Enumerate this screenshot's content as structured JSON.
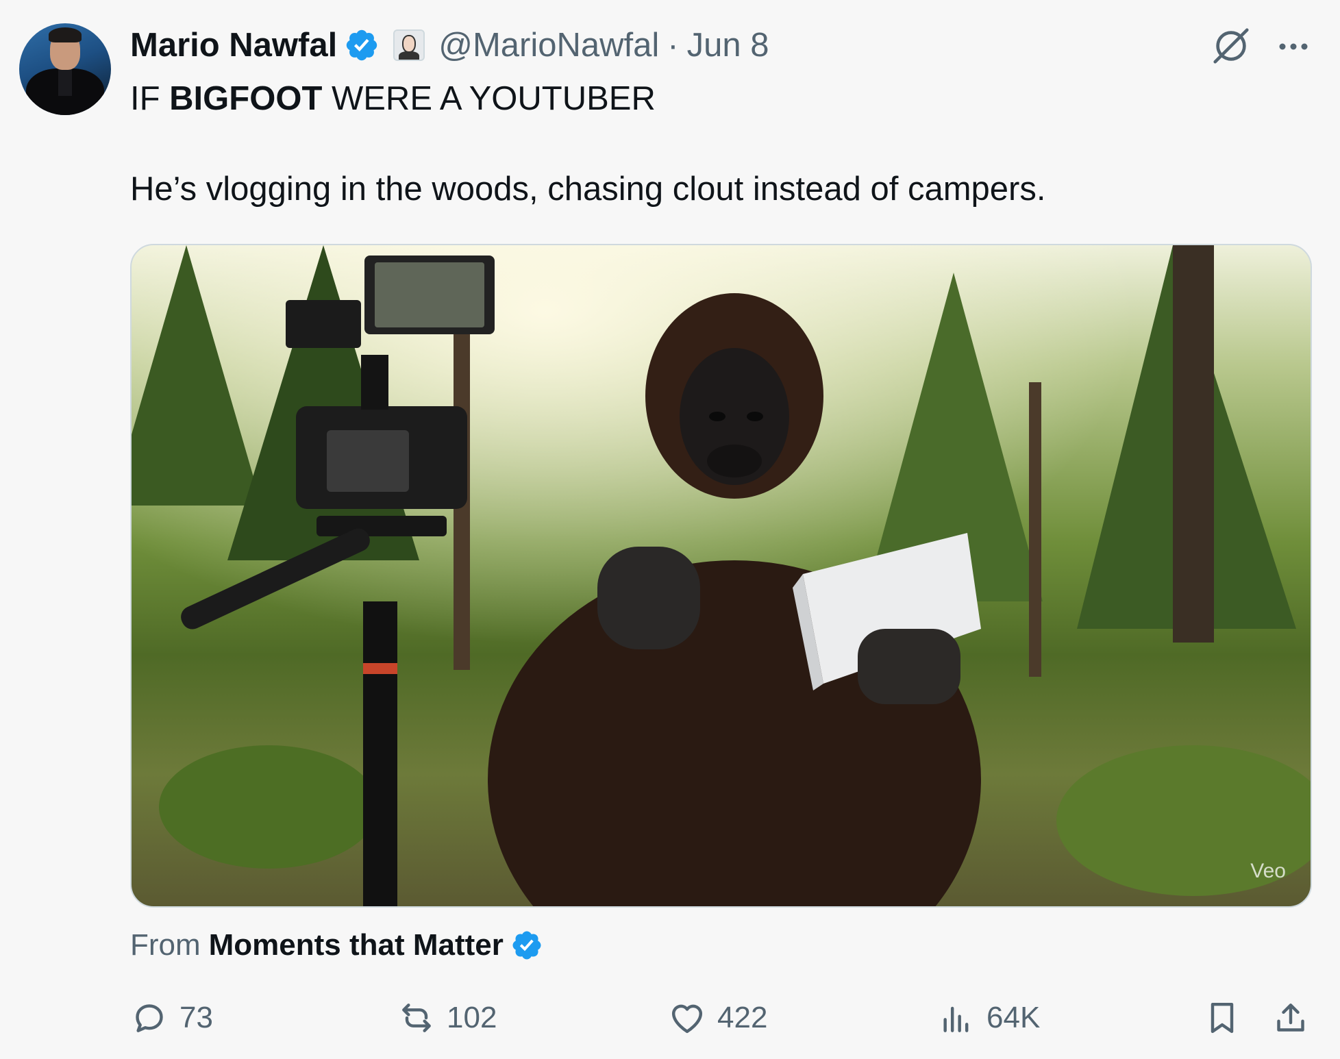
{
  "tweet": {
    "author_name": "Mario Nawfal",
    "handle": "@MarioNawfal",
    "separator": "·",
    "date": "Jun 8",
    "headline_pre": "IF ",
    "headline_bold": "BIGFOOT",
    "headline_post": " WERE A YOUTUBER",
    "body": "He’s vlogging in the woods, chasing clout instead of campers.",
    "media_watermark": "Veo",
    "from_label": "From",
    "from_source": "Moments that Matter"
  },
  "stats": {
    "replies": "73",
    "reposts": "102",
    "likes": "422",
    "views": "64K"
  },
  "icons": {
    "verified": "verified-badge-icon",
    "affiliate": "affiliate-badge-icon",
    "grok": "grok-icon",
    "more": "more-icon",
    "reply": "reply-icon",
    "repost": "repost-icon",
    "like": "heart-icon",
    "views": "views-icon",
    "bookmark": "bookmark-icon",
    "share": "share-icon"
  },
  "colors": {
    "verified": "#1d9bf0",
    "text": "#0f1419",
    "muted": "#536471",
    "background": "#f7f7f7"
  }
}
